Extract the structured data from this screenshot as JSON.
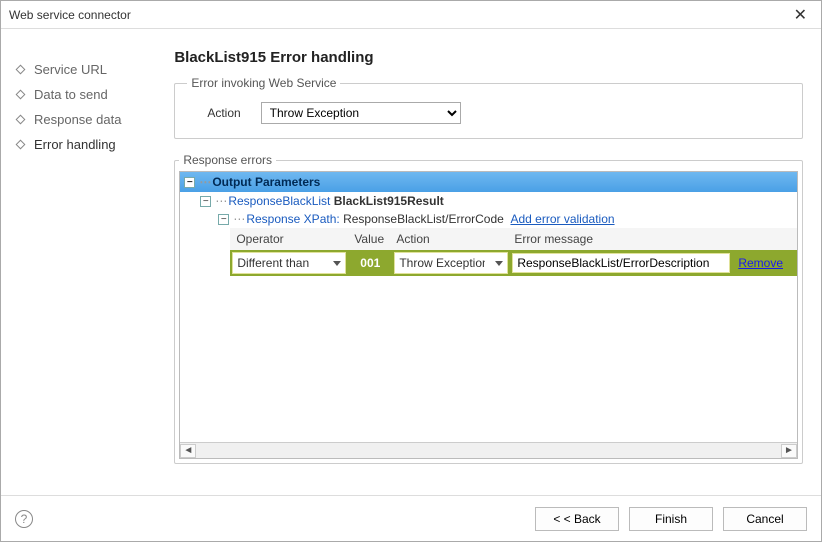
{
  "window": {
    "title": "Web service connector"
  },
  "nav": {
    "items": [
      {
        "label": "Service URL"
      },
      {
        "label": "Data to send"
      },
      {
        "label": "Response data"
      },
      {
        "label": "Error handling"
      }
    ]
  },
  "page": {
    "title": "BlackList915 Error handling"
  },
  "invoke_group": {
    "legend": "Error invoking Web Service",
    "action_label": "Action",
    "action_value": "Throw Exception"
  },
  "response_errors": {
    "legend": "Response errors",
    "root_label": "Output Parameters",
    "node1_link": "ResponseBlackList",
    "node1_bold": "BlackList915Result",
    "xpath_label": "Response XPath:",
    "xpath_value": "ResponseBlackList/ErrorCode",
    "add_validation": "Add error validation",
    "headers": {
      "operator": "Operator",
      "value": "Value",
      "action": "Action",
      "error_message": "Error message"
    },
    "row": {
      "operator": "Different than",
      "value": "001",
      "action": "Throw Exception",
      "error_message": "ResponseBlackList/ErrorDescription",
      "remove": "Remove"
    }
  },
  "footer": {
    "back": "< < Back",
    "finish": "Finish",
    "cancel": "Cancel"
  }
}
